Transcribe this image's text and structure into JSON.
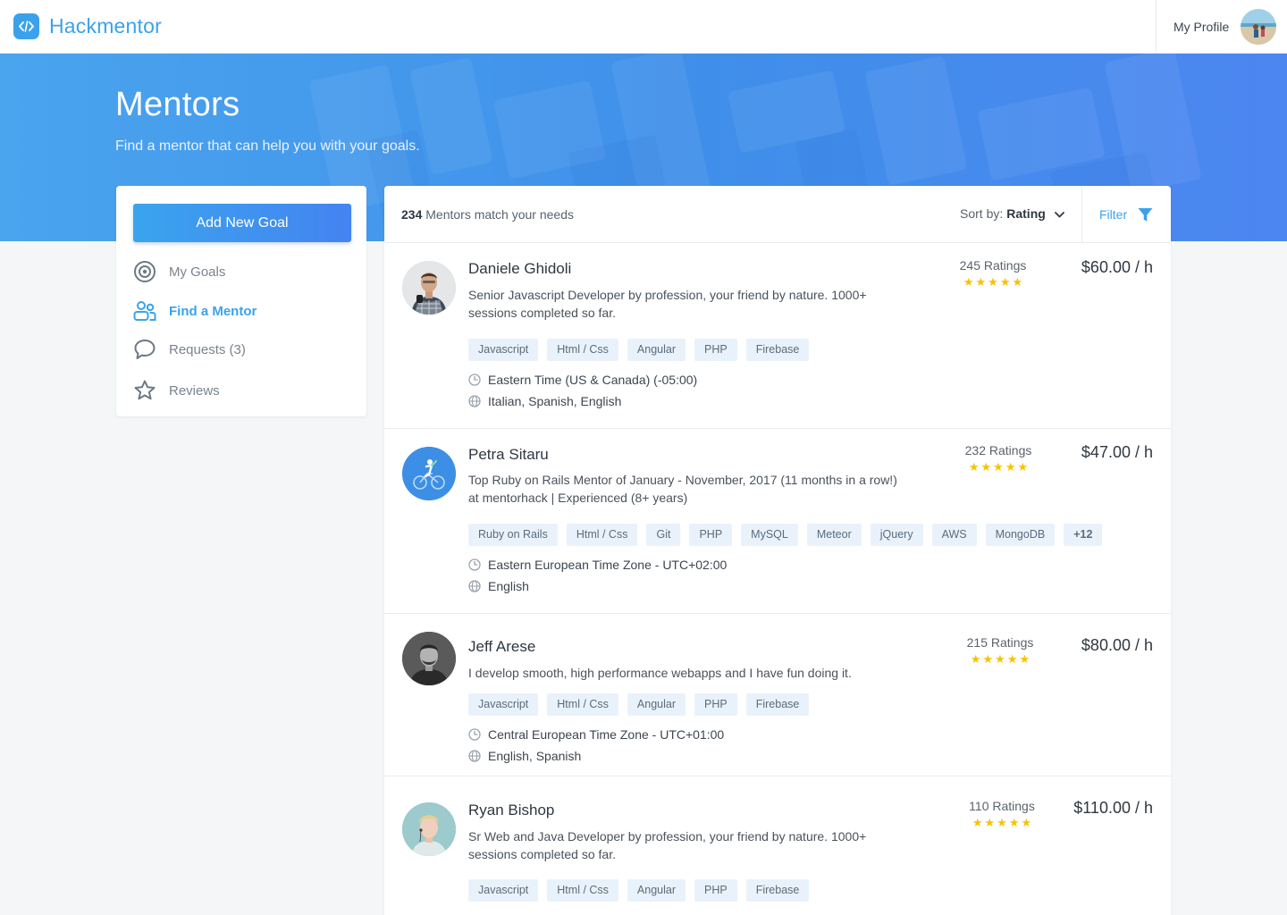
{
  "app": {
    "name": "Hackmentor"
  },
  "header": {
    "profile_label": "My Profile"
  },
  "hero": {
    "title": "Mentors",
    "subtitle": "Find a mentor that can help you with your goals."
  },
  "sidebar": {
    "add_goal_label": "Add New Goal",
    "items": [
      {
        "label": "My Goals",
        "icon": "target-icon",
        "active": false
      },
      {
        "label": "Find a Mentor",
        "icon": "users-icon",
        "active": true
      },
      {
        "label": "Requests (3)",
        "icon": "chat-bubble-icon",
        "active": false
      },
      {
        "label": "Reviews",
        "icon": "star-icon",
        "active": false
      }
    ]
  },
  "results": {
    "count": "234",
    "count_suffix": "Mentors match your needs",
    "sort_label": "Sort by:",
    "sort_value": "Rating",
    "filter_label": "Filter"
  },
  "mentors": [
    {
      "name": "Daniele Ghidoli",
      "bio": "Senior Javascript Developer by profession, your friend by nature. 1000+ sessions completed so far.",
      "tags": [
        "Javascript",
        "Html / Css",
        "Angular",
        "PHP",
        "Firebase"
      ],
      "timezone": "Eastern Time (US & Canada) (-05:00)",
      "languages": "Italian, Spanish, English",
      "ratings": "245 Ratings",
      "stars": 5,
      "price": "$60.00 / h"
    },
    {
      "name": "Petra Sitaru",
      "bio": "Top Ruby on Rails Mentor of January - November, 2017 (11 months in a row!) at mentorhack | Experienced (8+ years)",
      "tags": [
        "Ruby on Rails",
        "Html / Css",
        "Git",
        "PHP",
        "MySQL",
        "Meteor",
        "jQuery",
        "AWS",
        "MongoDB",
        "+12"
      ],
      "timezone": "Eastern European Time Zone - UTC+02:00",
      "languages": "English",
      "ratings": "232 Ratings",
      "stars": 5,
      "price": "$47.00 / h"
    },
    {
      "name": "Jeff Arese",
      "bio": "I develop smooth, high performance webapps and I have fun doing it.",
      "tags": [
        "Javascript",
        "Html / Css",
        "Angular",
        "PHP",
        "Firebase"
      ],
      "timezone": "Central European Time Zone - UTC+01:00",
      "languages": "English, Spanish",
      "ratings": "215 Ratings",
      "stars": 5,
      "price": "$80.00 / h"
    },
    {
      "name": "Ryan Bishop",
      "bio": "Sr Web and Java Developer by profession, your friend by nature. 1000+ sessions completed so far.",
      "tags": [
        "Javascript",
        "Html / Css",
        "Angular",
        "PHP",
        "Firebase"
      ],
      "timezone": "",
      "languages": "",
      "ratings": "110 Ratings",
      "stars": 5,
      "price": "$110.00 / h"
    }
  ],
  "colors": {
    "brand": "#3aa2ec",
    "star": "#f7c200",
    "tag_bg": "#e9f2fb"
  }
}
